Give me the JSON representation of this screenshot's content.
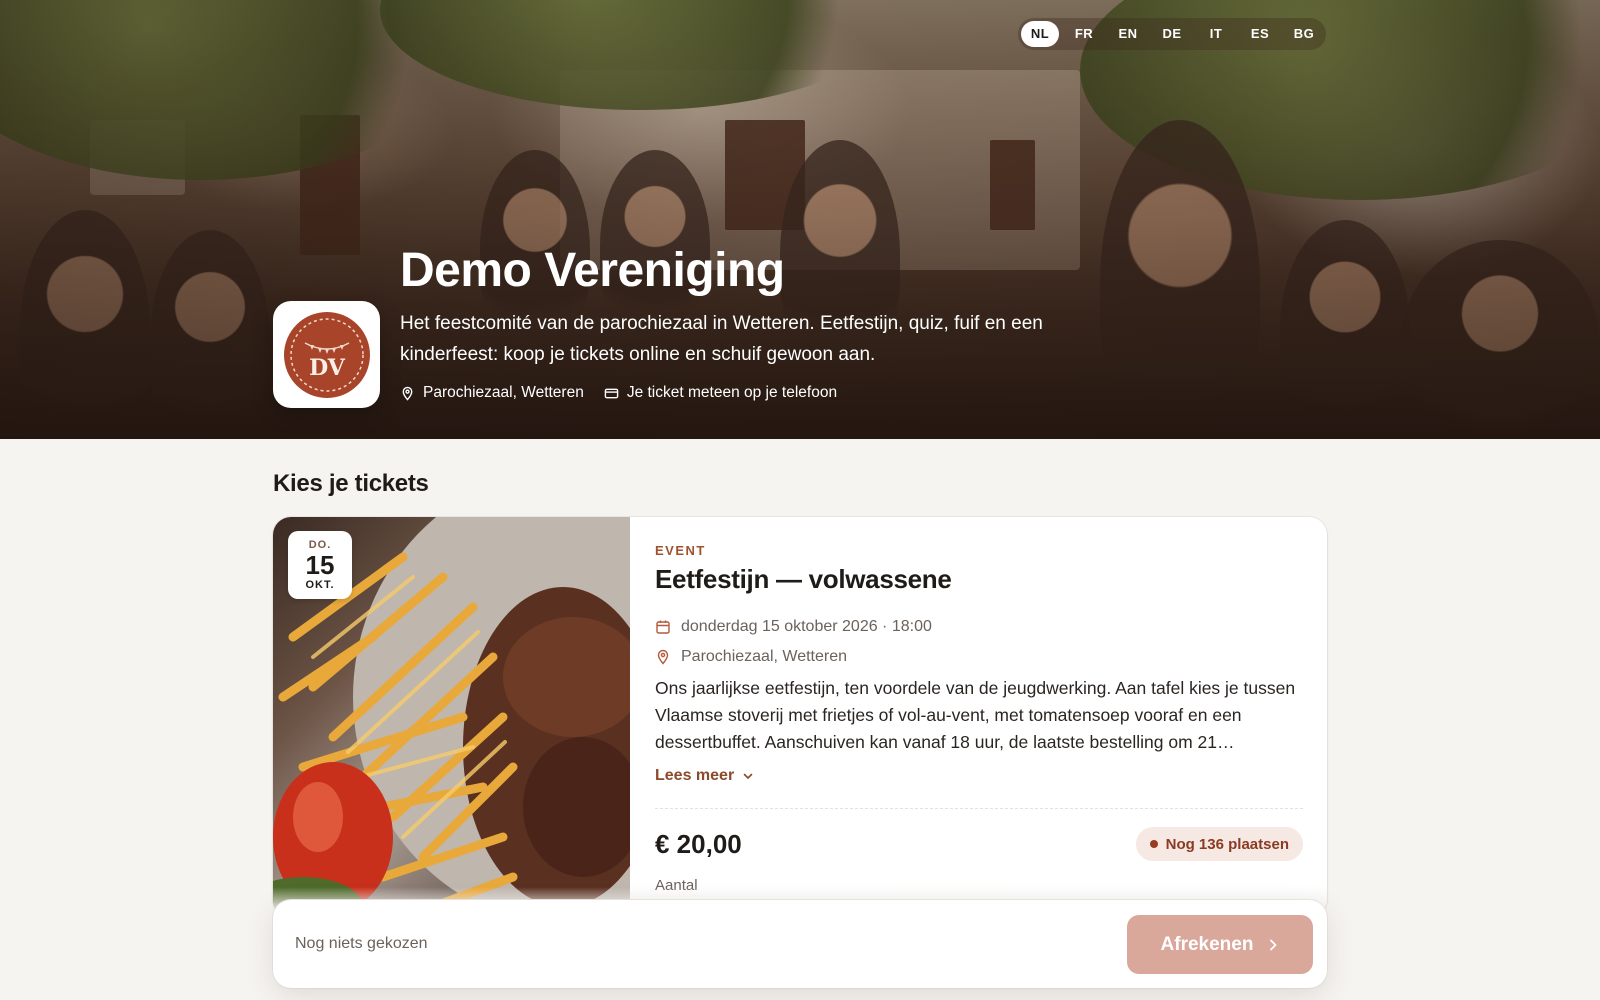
{
  "languages": {
    "items": [
      "NL",
      "FR",
      "EN",
      "DE",
      "IT",
      "ES",
      "BG"
    ],
    "active": "NL"
  },
  "organization": {
    "name": "Demo Vereniging",
    "logo_text": "DV",
    "description": "Het feestcomité van de parochiezaal in Wetteren. Eetfestijn, quiz, fuif en een kinderfeest: koop je tickets online en schuif gewoon aan.",
    "location": "Parochiezaal, Wetteren",
    "ticket_info": "Je ticket meteen op je telefoon"
  },
  "tickets": {
    "section_title": "Kies je tickets"
  },
  "event": {
    "date_badge": {
      "dow": "DO.",
      "day": "15",
      "month": "OKT."
    },
    "kicker": "EVENT",
    "title": "Eetfestijn — volwassene",
    "datetime": "donderdag 15 oktober 2026 · 18:00",
    "location": "Parochiezaal, Wetteren",
    "description": "Ons jaarlijkse eetfestijn, ten voordele van de jeugdwerking. Aan tafel kies je tussen Vlaamse stoverij met frietjes of vol-au-vent, met tomatensoep vooraf en een dessertbuffet. Aanschuiven kan vanaf 18 uur, de laatste bestelling om 21…",
    "read_more": "Lees meer",
    "price": "€ 20,00",
    "availability": "Nog 136 plaatsen",
    "quantity_label": "Aantal"
  },
  "checkout": {
    "status": "Nog niets gekozen",
    "button": "Afrekenen"
  },
  "colors": {
    "accent": "#a0522d",
    "button_disabled": "#d9a89a",
    "background": "#f6f4f1"
  }
}
